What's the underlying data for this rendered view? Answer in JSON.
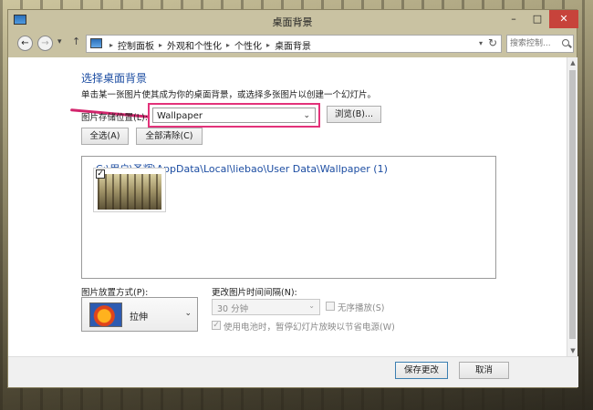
{
  "window": {
    "title": "桌面背景",
    "controls": {
      "minimize": "–",
      "maximize": "□",
      "close": "✕"
    }
  },
  "nav": {
    "back_glyph": "←",
    "forward_glyph": "→",
    "recent_glyph": "▾",
    "up_glyph": "↑",
    "breadcrumbs": [
      "控制面板",
      "外观和个性化",
      "个性化",
      "桌面背景"
    ],
    "crumb_separator": "▸",
    "dropdown_glyph": "▾",
    "refresh_glyph": "↻",
    "search_placeholder": "搜索控制..."
  },
  "main": {
    "heading": "选择桌面背景",
    "description": "单击某一张图片使其成为你的桌面背景，或选择多张图片以创建一个幻灯片。",
    "location_label": "图片存储位置(L):",
    "location_value": "Wallpaper",
    "dropdown_glyph": "⌄",
    "browse_label": "浏览(B)...",
    "select_all_label": "全选(A)",
    "clear_all_label": "全部清除(C)",
    "folder_path": "C:\\用户\\圣辉\\AppData\\Local\\liebao\\User Data\\Wallpaper (1)",
    "thumbnail_checked": true,
    "check_glyph": "✓",
    "position_label": "图片放置方式(P):",
    "position_value": "拉伸",
    "interval_label": "更改图片时间间隔(N):",
    "interval_value": "30 分钟",
    "shuffle_label": "无序播放(S)",
    "shuffle_checked": false,
    "battery_label": "使用电池时，暂停幻灯片放映以节省电源(W)",
    "battery_checked": true
  },
  "footer": {
    "save_label": "保存更改",
    "cancel_label": "取消"
  },
  "colors": {
    "heading_blue": "#1c4da2",
    "highlight_pink": "#e3327a"
  }
}
